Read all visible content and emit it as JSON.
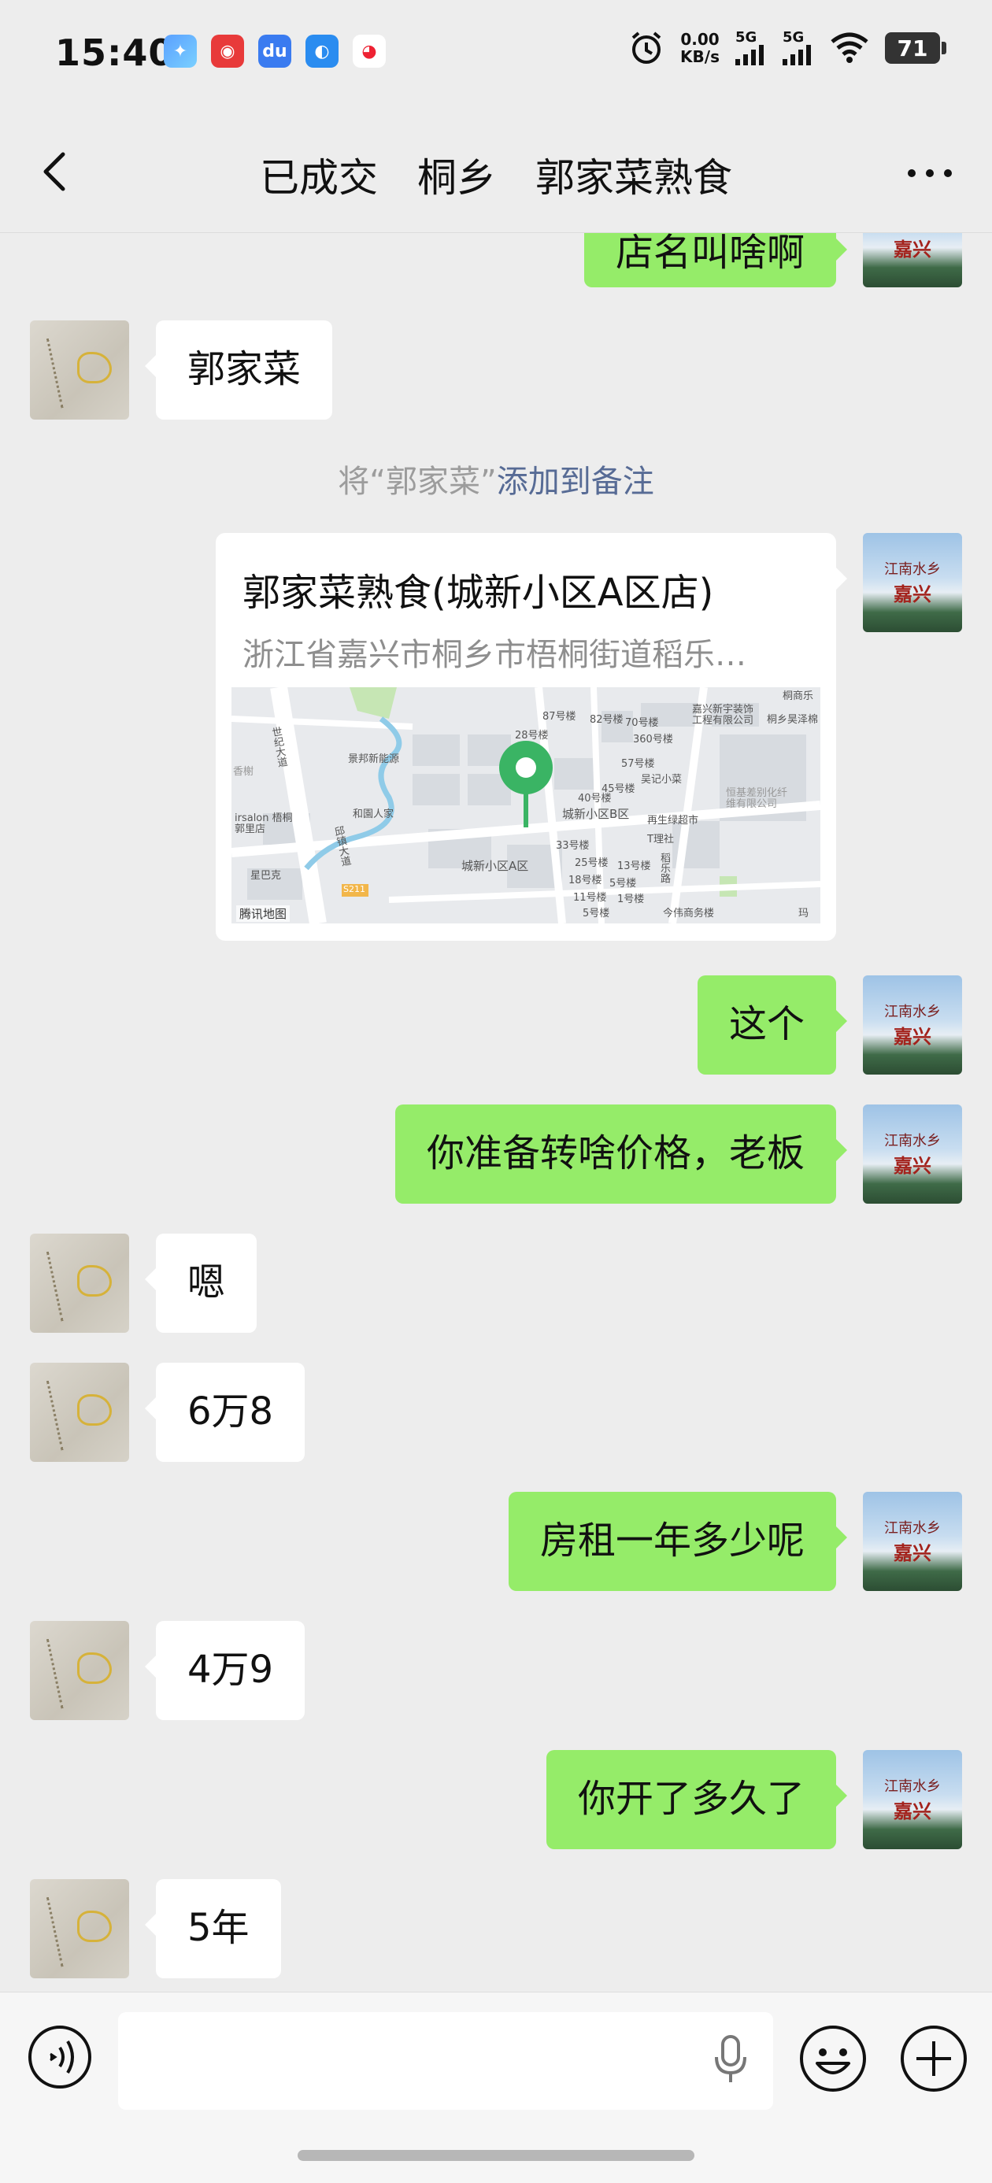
{
  "status": {
    "time": "15:40",
    "net_speed_value": "0.00",
    "net_speed_unit": "KB/s",
    "sig1": "5G",
    "sig2": "5G",
    "battery": "71"
  },
  "header": {
    "title": "已成交　桐乡　郭家菜熟食"
  },
  "messages": {
    "m0": "店名叫啥啊",
    "m1": "郭家菜",
    "m3": "这个",
    "m4": "你准备转啥价格，老板",
    "m5": "嗯",
    "m6": "6万8",
    "m7": "房租一年多少呢",
    "m8": "4万9",
    "m9": "你开了多久了",
    "m10": "5年"
  },
  "system_note": {
    "prefix": "将“郭家菜”",
    "link": "添加到备注"
  },
  "location": {
    "name": "郭家菜熟食(城新小区A区店)",
    "address": "浙江省嘉兴市桐乡市梧桐街道稻乐…",
    "map_brand": "腾讯地图",
    "map_labels": {
      "l1": "87号楼",
      "l2": "82号楼",
      "l3": "70号楼",
      "l4": "360号楼",
      "l5": "嘉兴新宇装饰工程有限公司",
      "l6": "桐乡昊泽棉",
      "l7": "景邦新能源",
      "l8": "57号楼",
      "l9": "吴记小菜",
      "l10": "45号楼",
      "l11": "城新小区B区",
      "l12": "再生绿超市",
      "l13": "T理社",
      "l14": "和園人家",
      "l15": "irsalon 梧桐郭里店",
      "l16": "星巴克",
      "l17": "城新小区A区",
      "l18": "33号楼",
      "l19": "25号楼",
      "l20": "18号楼",
      "l21": "11号楼",
      "l22": "5号楼",
      "l23": "今伟商务楼",
      "l24": "恒基差别化纤维有限公司",
      "l25": "世纪大道",
      "l26": "S211",
      "l27": "稻乐路",
      "l28": "香榭",
      "l29": "28号楼",
      "l30": "13号楼",
      "l31": "1号楼",
      "l32": "5号楼",
      "l33": "40号楼",
      "l34": "桐商乐",
      "l35": "邱镇大道",
      "l36": "玛"
    }
  },
  "avatars": {
    "right_top": "江南水乡",
    "right_bottom": "嘉兴"
  },
  "input": {
    "placeholder": ""
  }
}
